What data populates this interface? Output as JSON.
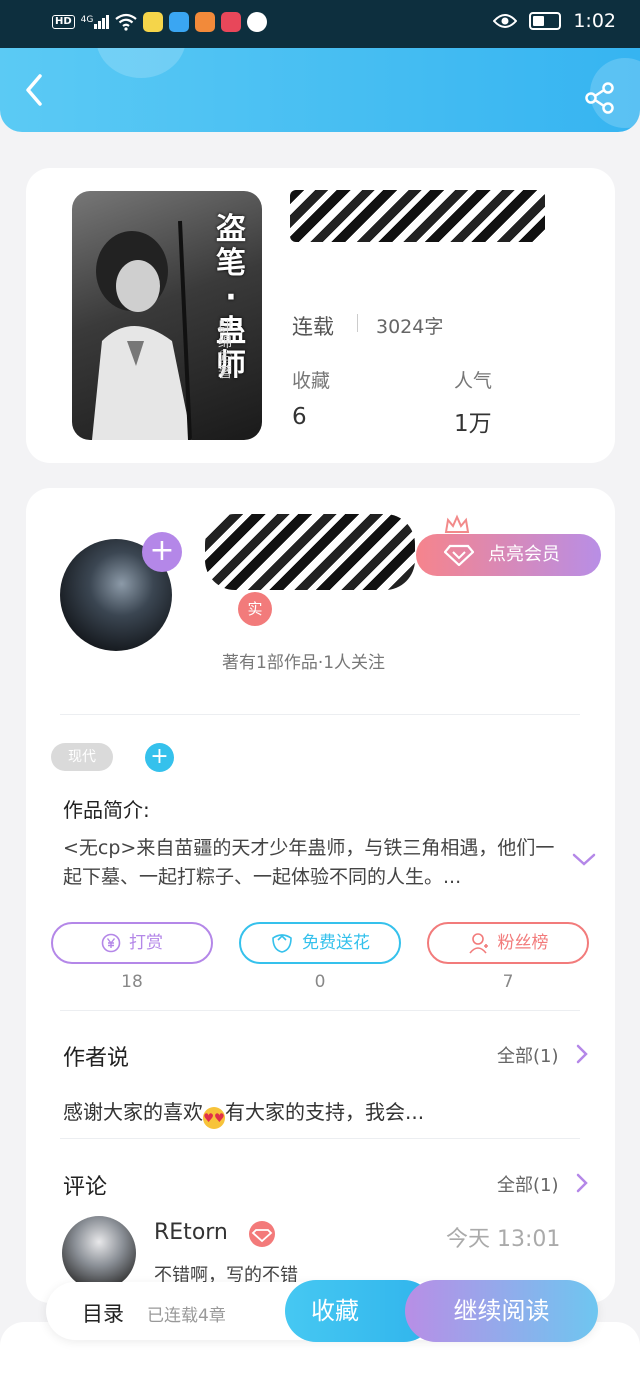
{
  "status_bar": {
    "time": "1:02",
    "network": "HD",
    "signal": "4G",
    "battery_level": 0.45
  },
  "book": {
    "cover_title_chars": [
      "盗",
      "笔",
      "·",
      "蛊",
      "师"
    ],
    "cover_author": "肆绵㊣著",
    "status": "连载",
    "word_count": "3024字",
    "favorites_label": "收藏",
    "favorites_value": "6",
    "popularity_label": "人气",
    "popularity_value": "1万"
  },
  "author": {
    "verified_badge": "实",
    "member_button": "点亮会员",
    "info": "著有1部作品·1人关注"
  },
  "tags": [
    "现代"
  ],
  "intro": {
    "title": "作品简介:",
    "text": "<无cp>来自苗疆的天才少年蛊师，与铁三角相遇，他们一起下墓、一起打粽子、一起体验不同的人生。..."
  },
  "actions": [
    {
      "label": "打赏",
      "count": "18",
      "color": "#b487e8"
    },
    {
      "label": "免费送花",
      "count": "0",
      "color": "#35c1ec"
    },
    {
      "label": "粉丝榜",
      "count": "7",
      "color": "#f27b7b"
    }
  ],
  "author_says": {
    "title": "作者说",
    "all": "全部(1)",
    "text_before": "感谢大家的喜欢",
    "text_after": "有大家的支持，我会..."
  },
  "comments": {
    "title": "评论",
    "all": "全部(1)",
    "items": [
      {
        "name": "REtorn",
        "time": "今天 13:01",
        "text": "不错啊，写的不错"
      }
    ]
  },
  "bottom": {
    "toc": "目录",
    "chapters": "已连载4章",
    "favorite": "收藏",
    "continue": "继续阅读"
  }
}
